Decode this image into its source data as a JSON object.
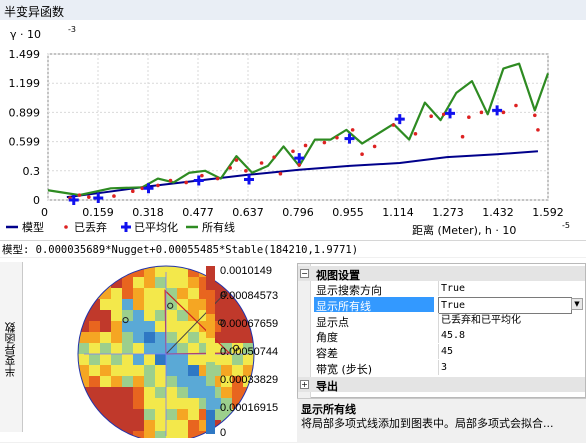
{
  "window": {
    "title": "半变异函数"
  },
  "chart_data": {
    "type": "scatter",
    "ylabel": "γ · 10^-3",
    "xlabel": "距离 (Meter), h · 10^-5",
    "yticks": [
      "0",
      "0.3",
      "0.599",
      "0.899",
      "1.199",
      "1.499"
    ],
    "xticks": [
      "0",
      "0.159",
      "0.318",
      "0.477",
      "0.637",
      "0.796",
      "0.955",
      "1.114",
      "1.273",
      "1.432",
      "1.592"
    ],
    "xlim": [
      0,
      1.592
    ],
    "ylim": [
      0,
      1.499
    ],
    "grid": true,
    "legend_position": "bottom",
    "series": [
      {
        "name": "模型",
        "kind": "line",
        "color": "#00008b",
        "x": [
          0.06,
          0.16,
          0.32,
          0.48,
          0.64,
          0.8,
          0.96,
          1.12,
          1.27,
          1.43,
          1.56
        ],
        "y": [
          0.03,
          0.07,
          0.14,
          0.2,
          0.26,
          0.31,
          0.35,
          0.38,
          0.44,
          0.47,
          0.5
        ]
      },
      {
        "name": "已丢弃",
        "kind": "points",
        "color": "#dd2222",
        "x": [
          0.07,
          0.1,
          0.13,
          0.21,
          0.27,
          0.3,
          0.35,
          0.39,
          0.44,
          0.49,
          0.54,
          0.58,
          0.6,
          0.63,
          0.68,
          0.72,
          0.74,
          0.78,
          0.8,
          0.82,
          0.88,
          0.92,
          0.97,
          1.0,
          1.04,
          1.1,
          1.17,
          1.22,
          1.26,
          1.32,
          1.34,
          1.38,
          1.45,
          1.49,
          1.55,
          1.56
        ],
        "y": [
          0.02,
          0.05,
          0.03,
          0.04,
          0.09,
          0.12,
          0.15,
          0.2,
          0.18,
          0.25,
          0.22,
          0.33,
          0.41,
          0.3,
          0.38,
          0.44,
          0.27,
          0.5,
          0.36,
          0.56,
          0.59,
          0.64,
          0.72,
          0.47,
          0.55,
          0.77,
          0.68,
          0.86,
          0.88,
          0.65,
          0.85,
          0.9,
          0.9,
          0.97,
          0.87,
          0.72
        ]
      },
      {
        "name": "已平均化",
        "kind": "points",
        "color": "#1111ee",
        "x": [
          0.082,
          0.16,
          0.32,
          0.48,
          0.64,
          0.8,
          0.96,
          1.12,
          1.28,
          1.43
        ],
        "y": [
          0.0,
          0.02,
          0.12,
          0.2,
          0.21,
          0.43,
          0.63,
          0.83,
          0.89,
          0.92
        ]
      },
      {
        "name": "所有线",
        "kind": "line",
        "color": "#2e8b22",
        "x": [
          0.0,
          0.1,
          0.2,
          0.3,
          0.35,
          0.4,
          0.45,
          0.5,
          0.55,
          0.6,
          0.65,
          0.7,
          0.75,
          0.8,
          0.85,
          0.9,
          0.95,
          1.0,
          1.05,
          1.1,
          1.15,
          1.2,
          1.25,
          1.3,
          1.35,
          1.4,
          1.45,
          1.5,
          1.55,
          1.592
        ],
        "y": [
          0.1,
          0.05,
          0.12,
          0.13,
          0.22,
          0.18,
          0.28,
          0.3,
          0.22,
          0.45,
          0.28,
          0.35,
          0.55,
          0.35,
          0.62,
          0.62,
          0.72,
          0.58,
          0.68,
          0.78,
          0.62,
          1.0,
          0.82,
          1.1,
          1.22,
          0.88,
          1.35,
          1.4,
          0.92,
          1.3
        ]
      }
    ]
  },
  "legend": {
    "model": "模型",
    "discarded": "已丢弃",
    "averaged": "已平均化",
    "all_lines": "所有线"
  },
  "model_string": "模型: 0.000035689*Nugget+0.00055485*Stable(184210,1.9771)",
  "surface": {
    "tab_label": "半变异函数",
    "scale": [
      "0.0010149",
      "0.00084573",
      "0.00067659",
      "0.00050744",
      "0.00033829",
      "0.00016915",
      "0"
    ],
    "scale_colors": [
      "#c0392b",
      "#e8651f",
      "#f5a623",
      "#f3e84b",
      "#9ccf8d",
      "#5aa9d6",
      "#2f78c4"
    ]
  },
  "props": {
    "group1": "视图设置",
    "rows": [
      {
        "key": "显示搜索方向",
        "value": "True"
      },
      {
        "key": "显示所有线",
        "value": "True",
        "selected": true
      },
      {
        "key": "显示点",
        "value": "已丢弃和已平均化"
      },
      {
        "key": "角度",
        "value": "45.8"
      },
      {
        "key": "容差",
        "value": "45"
      },
      {
        "key": "带宽 (步长)",
        "value": "3"
      }
    ],
    "group2": "导出",
    "desc_title": "显示所有线",
    "desc_body": "将局部多项式线添加到图表中。局部多项式会拟合..."
  }
}
